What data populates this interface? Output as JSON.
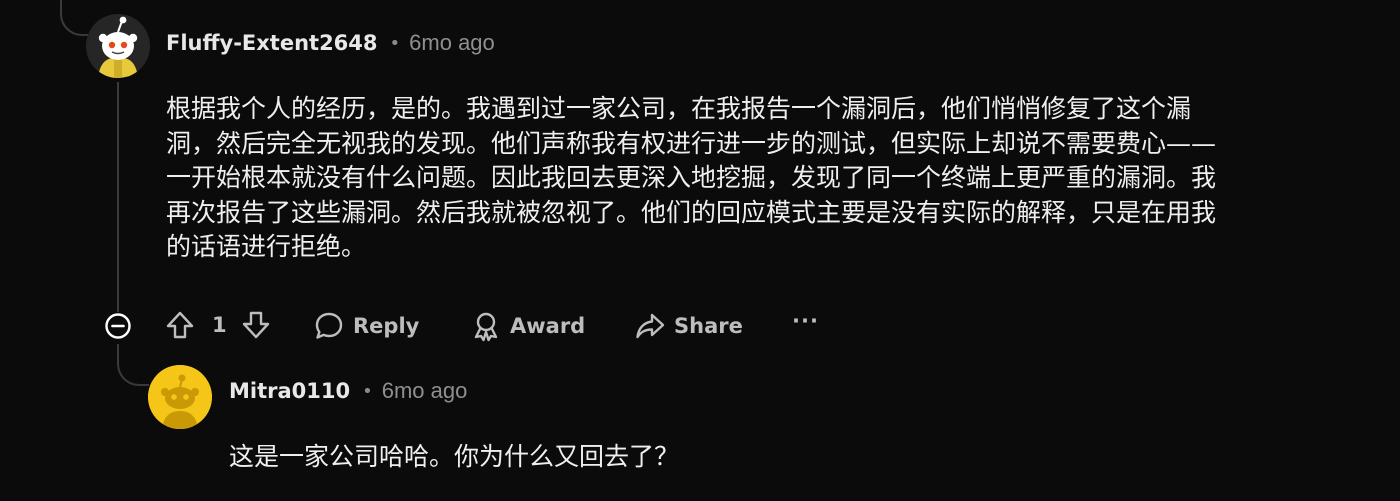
{
  "comment": {
    "author": "Fluffy-Extent2648",
    "separator": "•",
    "age": "6mo ago",
    "lines": [
      "根据我个人的经历，是的。我遇到过一家公司，在我报告一个漏洞后，他们悄悄修复了这个漏",
      "洞，然后完全无视我的发现。他们声称我有权进行进一步的测试，但实际上却说不需要费心——",
      "一开始根本就没有什么问题。因此我回去更深入地挖掘，发现了同一个终端上更严重的漏洞。我",
      "再次报告了这些漏洞。然后我就被忽视了。他们的回应模式主要是没有实际的解释，只是在用我",
      "的话语进行拒绝。"
    ],
    "vote_count": "1",
    "reply_label": "Reply",
    "award_label": "Award",
    "share_label": "Share",
    "more_label": "···"
  },
  "reply": {
    "author": "Mitra0110",
    "separator": "•",
    "age": "6mo ago",
    "text": "这是一家公司哈哈。你为什么又回去了？"
  },
  "colors": {
    "background": "#0b0b0b",
    "text": "#efefef",
    "muted": "#8f8f8f",
    "action": "#bdbdbd",
    "thread_line": "#3a3a3a",
    "reply_avatar": "#f5c518"
  }
}
